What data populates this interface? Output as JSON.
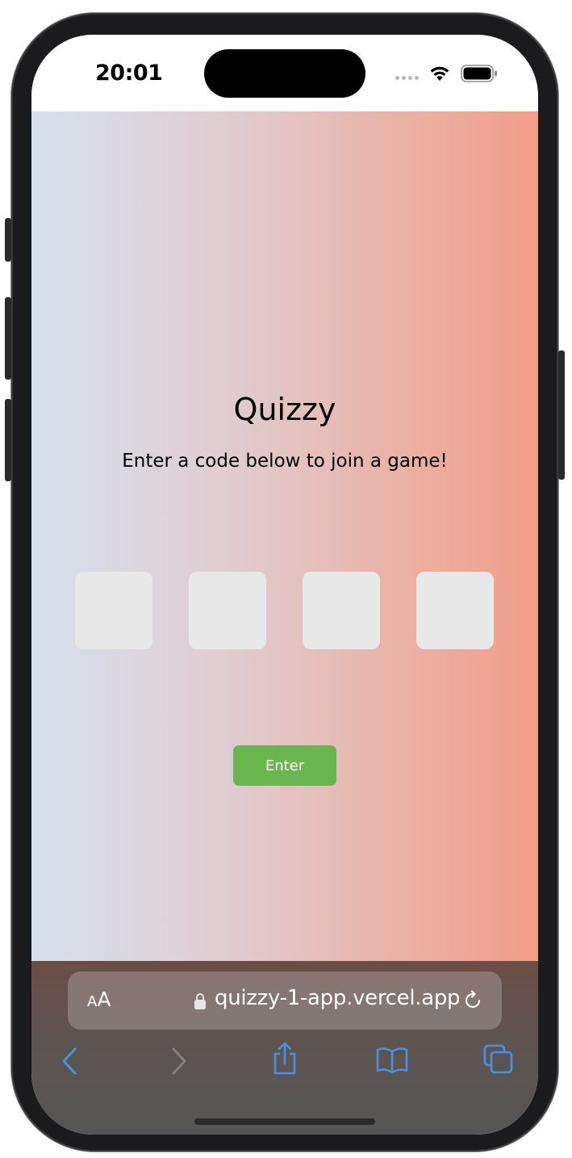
{
  "status_bar": {
    "time": "20:01",
    "icons": [
      "cellular-signal-icon",
      "wifi-icon",
      "battery-icon"
    ]
  },
  "main": {
    "title": "Quizzy",
    "subtitle": "Enter a code below to join a game!",
    "code_inputs": [
      {
        "value": "",
        "placeholder": ""
      },
      {
        "value": "",
        "placeholder": ""
      },
      {
        "value": "",
        "placeholder": ""
      },
      {
        "value": "",
        "placeholder": ""
      }
    ],
    "enter_label": "Enter"
  },
  "browser": {
    "text_size_small": "A",
    "text_size_large": "A",
    "url": "quizzy-1-app.vercel.app",
    "toolbar_icons": [
      "back-icon",
      "forward-icon",
      "share-icon",
      "bookmarks-icon",
      "tabs-icon"
    ]
  },
  "colors": {
    "gradient_left": "#d6e1ec",
    "gradient_right": "#f29f89",
    "enter_button": "#6ab750",
    "code_box": "#e8e8e8",
    "safari_accent": "#4a90e2"
  }
}
